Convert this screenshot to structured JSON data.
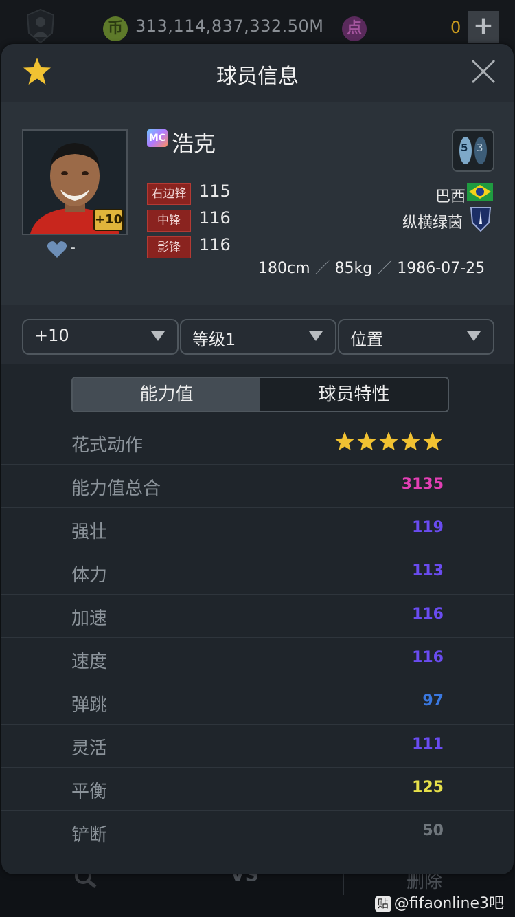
{
  "topbar": {
    "coin_badge": "币",
    "coins": "313,114,837,332.50M",
    "point_badge": "点",
    "points": "0",
    "add_label": "+"
  },
  "modal": {
    "title": "球员信息",
    "close_icon": "close-icon",
    "favorite_icon": "star-icon"
  },
  "player": {
    "season_badge": "MC",
    "name": "浩克",
    "enhance_badge": "+10",
    "likes": "-",
    "foot_left": "5",
    "foot_right": "3",
    "positions": [
      {
        "label": "右边锋",
        "value": "115"
      },
      {
        "label": "中锋",
        "value": "116"
      },
      {
        "label": "影锋",
        "value": "116"
      }
    ],
    "nation": "巴西",
    "team": "纵横绿茵",
    "height": "180cm",
    "weight": "85kg",
    "birthdate": "1986-07-25"
  },
  "controls": {
    "enhance": "+10",
    "level": "等级1",
    "position": "位置"
  },
  "tabs": {
    "ability": "能力值",
    "traits": "球员特性"
  },
  "stats": [
    {
      "label": "花式动作",
      "value": "",
      "stars": 5
    },
    {
      "label": "能力值总合",
      "value": "3135",
      "color": "#e23fb4"
    },
    {
      "label": "强壮",
      "value": "119",
      "color": "#6a4cf0"
    },
    {
      "label": "体力",
      "value": "113",
      "color": "#6a4cf0"
    },
    {
      "label": "加速",
      "value": "116",
      "color": "#6a4cf0"
    },
    {
      "label": "速度",
      "value": "116",
      "color": "#6a4cf0"
    },
    {
      "label": "弹跳",
      "value": "97",
      "color": "#3a78e0"
    },
    {
      "label": "灵活",
      "value": "111",
      "color": "#6a4cf0"
    },
    {
      "label": "平衡",
      "value": "125",
      "color": "#e6e04a"
    },
    {
      "label": "铲断",
      "value": "50",
      "color": "#6f767c"
    }
  ],
  "bottomnav": {
    "vs_label": "VS",
    "delete_label": "删除"
  },
  "watermark": {
    "badge": "贴",
    "text": "@fifaonline3吧"
  }
}
